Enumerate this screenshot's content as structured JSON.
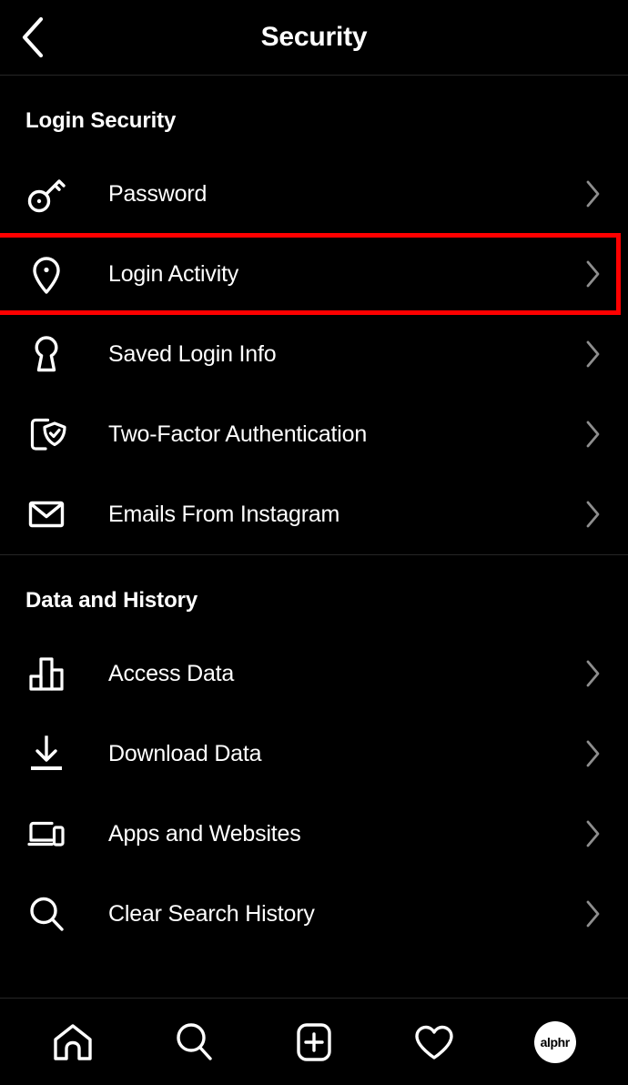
{
  "header": {
    "title": "Security",
    "back_icon": "chevron-left-icon"
  },
  "sections": [
    {
      "title": "Login Security",
      "items": [
        {
          "label": "Password",
          "icon": "key-icon",
          "highlighted": false
        },
        {
          "label": "Login Activity",
          "icon": "location-pin-icon",
          "highlighted": true
        },
        {
          "label": "Saved Login Info",
          "icon": "keyhole-icon",
          "highlighted": false
        },
        {
          "label": "Two-Factor Authentication",
          "icon": "phone-shield-check-icon",
          "highlighted": false
        },
        {
          "label": "Emails From Instagram",
          "icon": "envelope-icon",
          "highlighted": false
        }
      ]
    },
    {
      "title": "Data and History",
      "items": [
        {
          "label": "Access Data",
          "icon": "bar-chart-icon",
          "highlighted": false
        },
        {
          "label": "Download Data",
          "icon": "download-icon",
          "highlighted": false
        },
        {
          "label": "Apps and Websites",
          "icon": "devices-icon",
          "highlighted": false
        },
        {
          "label": "Clear Search History",
          "icon": "search-icon",
          "highlighted": false
        }
      ]
    }
  ],
  "bottom_nav": [
    {
      "name": "home-icon",
      "label": ""
    },
    {
      "name": "search-icon",
      "label": ""
    },
    {
      "name": "new-post-icon",
      "label": ""
    },
    {
      "name": "heart-icon",
      "label": ""
    },
    {
      "name": "profile-avatar",
      "label": "alphr"
    }
  ],
  "colors": {
    "background": "#000000",
    "text": "#ffffff",
    "chevron": "#8e8e8e",
    "divider": "#262626",
    "highlight": "#fe0000",
    "avatar_bg": "#ffffff"
  },
  "chevron_glyph": "chevron-right-icon"
}
